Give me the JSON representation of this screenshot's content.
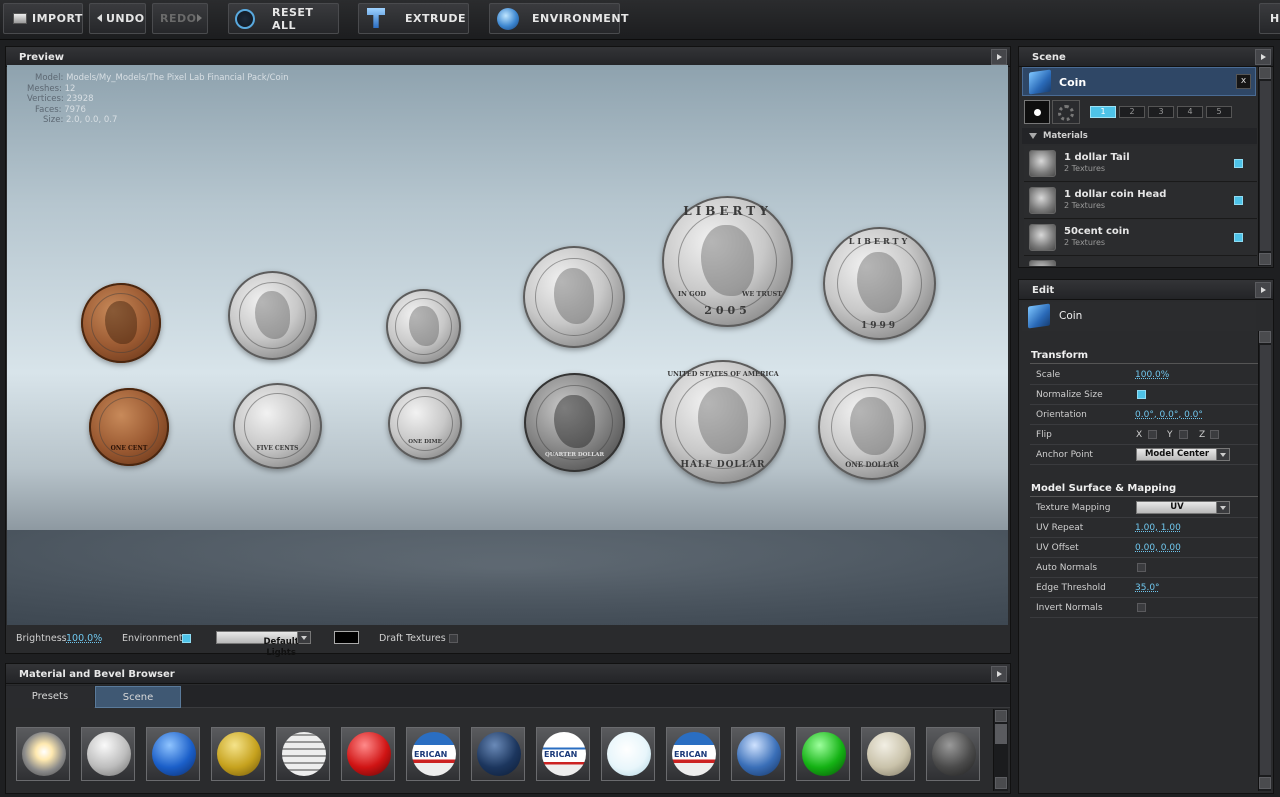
{
  "toolbar": {
    "import": "IMPORT",
    "undo": "UNDO",
    "redo": "REDO",
    "reset_all": "RESET ALL",
    "extrude": "EXTRUDE",
    "environment": "ENVIRONMENT",
    "help_stub": "H"
  },
  "preview": {
    "title": "Preview",
    "info": {
      "model_label": "Model:",
      "model_value": "Models/My_Models/The Pixel Lab Financial Pack/Coin",
      "meshes_label": "Meshes:",
      "meshes_value": "12",
      "vertices_label": "Vertices:",
      "vertices_value": "23928",
      "faces_label": "Faces:",
      "faces_value": "7976",
      "size_label": "Size:",
      "size_value": "2.0, 0.0, 0.7"
    },
    "coins": {
      "c1_top": "LIBERTY",
      "c1_year": "2005",
      "c1_left": "IN GOD",
      "c1_right": "WE TRUST",
      "c2_top": "LIBERTY",
      "c2_year": "1999",
      "r2_a": "ONE CENT",
      "r2_b": "FIVE CENTS",
      "r2_c": "ONE DIME",
      "r2_d": "QUARTER DOLLAR",
      "r2_e_top": "UNITED STATES OF AMERICA",
      "r2_e": "HALF DOLLAR",
      "r2_f": "ONE DOLLAR"
    },
    "bottom": {
      "brightness_label": "Brightness",
      "brightness_value": "100.0%",
      "environment_label": "Environment",
      "lights_value": "Default Lights",
      "draft_label": "Draft Textures"
    }
  },
  "browser": {
    "title": "Material and Bevel Browser",
    "tab_presets": "Presets",
    "tab_scene": "Scene",
    "swatch_labels": [
      "ERICAN",
      "ERICAN",
      "ERICAN"
    ]
  },
  "scene": {
    "title": "Scene",
    "object_name": "Coin",
    "close": "x",
    "layer_tabs": [
      "1",
      "2",
      "3",
      "4",
      "5"
    ],
    "materials_header": "Materials",
    "materials": [
      {
        "name": "1 dollar Tail",
        "sub": "2 Textures"
      },
      {
        "name": "1 dollar coin Head",
        "sub": "2 Textures"
      },
      {
        "name": "50cent coin",
        "sub": "2 Textures"
      }
    ]
  },
  "edit": {
    "title": "Edit",
    "object_name": "Coin",
    "transform_header": "Transform",
    "scale_label": "Scale",
    "scale_value": "100.0%",
    "normalize_label": "Normalize Size",
    "orientation_label": "Orientation",
    "orientation_value": "0.0°, 0.0°, 0.0°",
    "flip_label": "Flip",
    "flip_x": "X",
    "flip_y": "Y",
    "flip_z": "Z",
    "anchor_label": "Anchor Point",
    "anchor_value": "Model Center",
    "surface_header": "Model Surface & Mapping",
    "mapping_label": "Texture Mapping",
    "mapping_value": "UV",
    "uv_repeat_label": "UV Repeat",
    "uv_repeat_value": "1.00, 1.00",
    "uv_offset_label": "UV Offset",
    "uv_offset_value": "0.00, 0.00",
    "auto_normals_label": "Auto Normals",
    "edge_label": "Edge Threshold",
    "edge_value": "35.0°",
    "invert_label": "Invert Normals"
  },
  "colors": {
    "accent": "#4ec3e8",
    "panel": "#2a2b2d",
    "background": "#1e1f21"
  }
}
